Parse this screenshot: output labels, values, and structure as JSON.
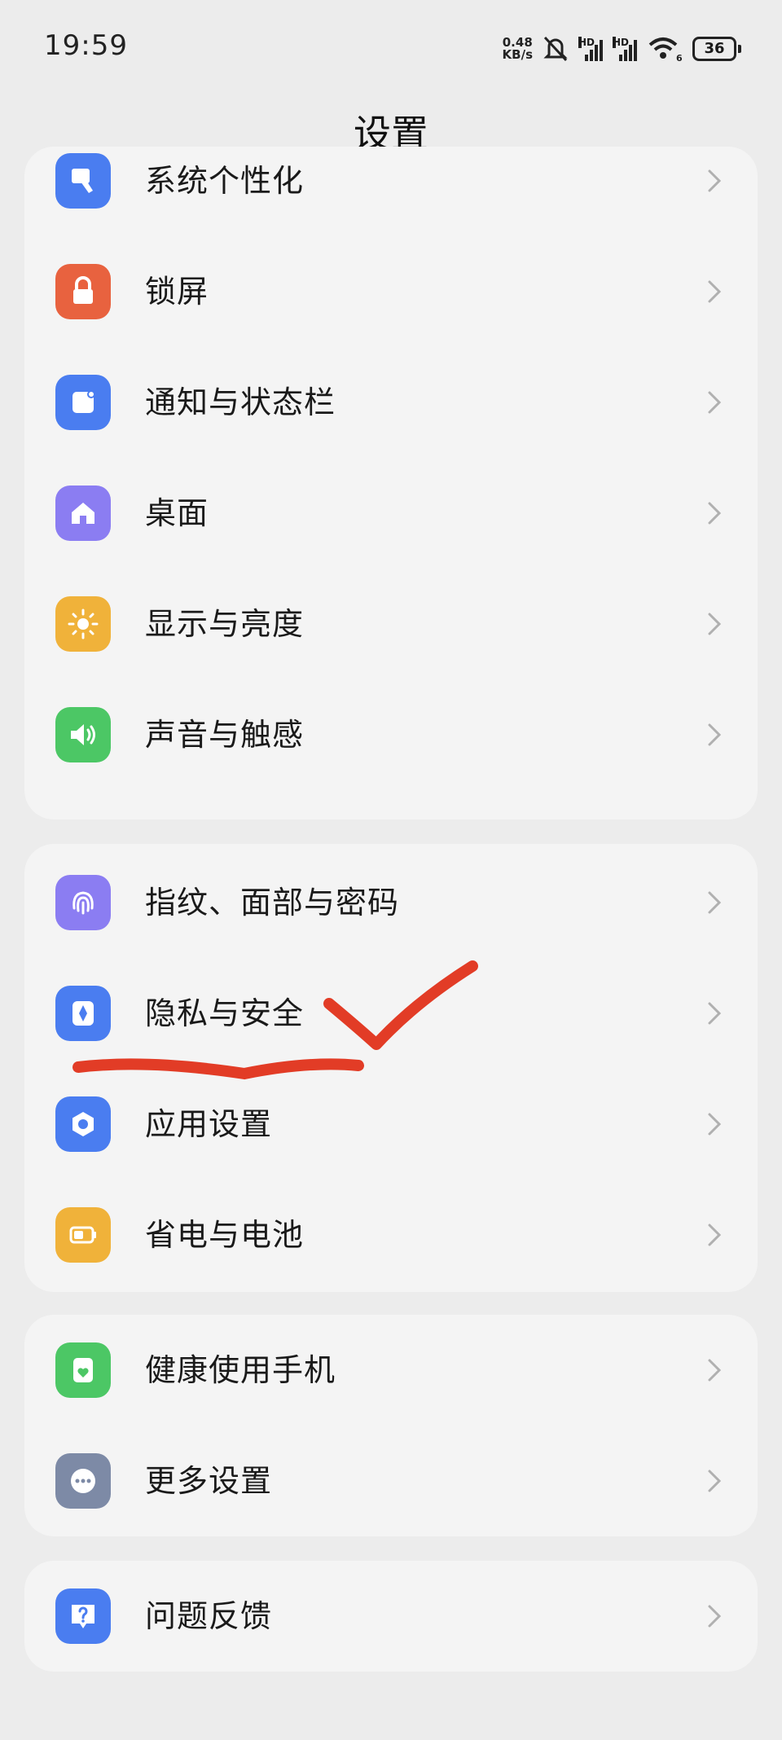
{
  "status_bar": {
    "time": "19:59",
    "net_speed_value": "0.48",
    "net_speed_unit": "KB/s",
    "sim1_label": "HD",
    "sim2_label": "HD",
    "wifi_label": "6",
    "battery": "36"
  },
  "page": {
    "title": "设置"
  },
  "groups": [
    {
      "items": [
        {
          "label": "系统个性化",
          "icon": "personalization-icon",
          "color": "#4a7df0"
        },
        {
          "label": "锁屏",
          "icon": "lock-icon",
          "color": "#e8623f"
        },
        {
          "label": "通知与状态栏",
          "icon": "notification-icon",
          "color": "#4a7df0"
        },
        {
          "label": "桌面",
          "icon": "home-icon",
          "color": "#8b7df2"
        },
        {
          "label": "显示与亮度",
          "icon": "sun-icon",
          "color": "#f0b23a"
        },
        {
          "label": "声音与触感",
          "icon": "speaker-icon",
          "color": "#4cc765"
        }
      ]
    },
    {
      "items": [
        {
          "label": "指纹、面部与密码",
          "icon": "fingerprint-icon",
          "color": "#8b7df2"
        },
        {
          "label": "隐私与安全",
          "icon": "privacy-shield-icon",
          "color": "#4a7df0"
        },
        {
          "label": "应用设置",
          "icon": "app-settings-icon",
          "color": "#4a7df0"
        },
        {
          "label": "省电与电池",
          "icon": "battery-icon",
          "color": "#f0b23a"
        }
      ]
    },
    {
      "items": [
        {
          "label": "健康使用手机",
          "icon": "healthy-usage-icon",
          "color": "#4cc765"
        },
        {
          "label": "更多设置",
          "icon": "more-dots-icon",
          "color": "#7d8aa6"
        }
      ]
    },
    {
      "items": [
        {
          "label": "问题反馈",
          "icon": "feedback-question-icon",
          "color": "#4a7df0"
        }
      ]
    }
  ],
  "annotation_color": "#e23c26"
}
